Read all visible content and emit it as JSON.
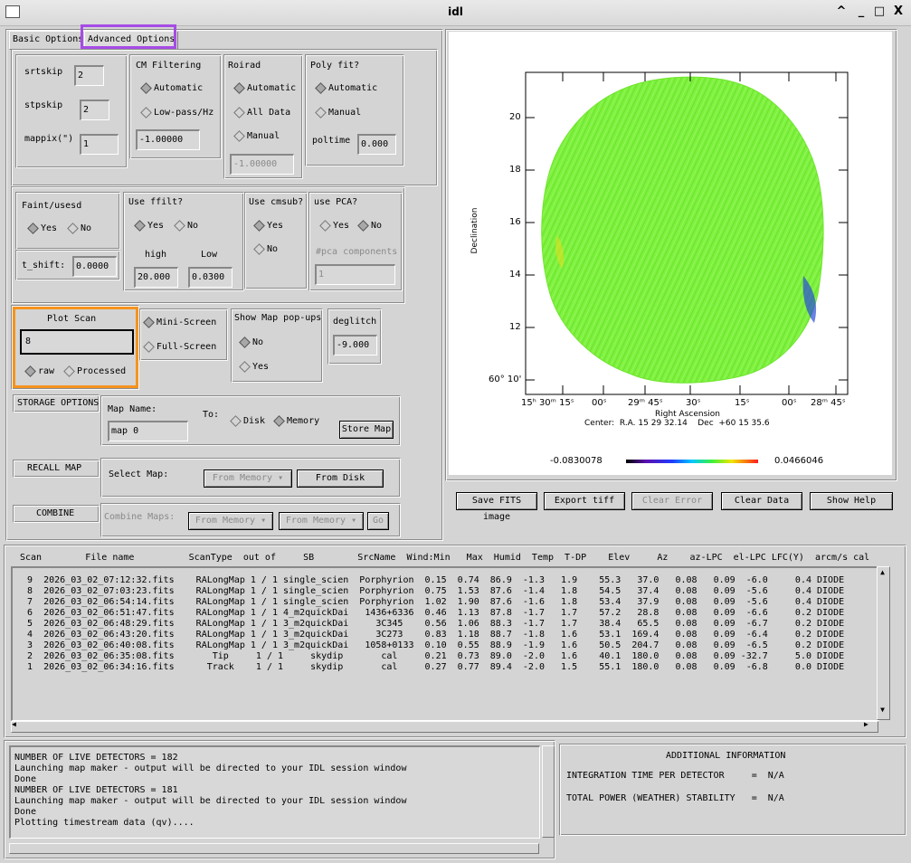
{
  "window": {
    "title": "idl",
    "controls": [
      "^",
      "_",
      "□",
      "X"
    ]
  },
  "tabs": [
    {
      "label": "Basic Options"
    },
    {
      "label": "Advanced Options"
    }
  ],
  "advanced": {
    "srtskip": {
      "label": "srtskip",
      "value": "2"
    },
    "stpskip": {
      "label": "stpskip",
      "value": "2"
    },
    "mappix": {
      "label": "mappix(\")",
      "value": "1"
    },
    "cm_filtering": {
      "label": "CM Filtering",
      "opt1": "Automatic",
      "opt2": "Low-pass/Hz",
      "value": "-1.00000"
    },
    "roirad": {
      "label": "Roirad",
      "opt1": "Automatic",
      "opt2": "All Data",
      "opt3": "Manual",
      "value": "-1.00000"
    },
    "polyfit": {
      "label": "Poly fit?",
      "opt1": "Automatic",
      "opt2": "Manual",
      "poltime_label": "poltime",
      "poltime_value": "0.000"
    },
    "faint": {
      "label": "Faint/usesd",
      "yes": "Yes",
      "no": "No"
    },
    "tshift": {
      "label": "t_shift:",
      "value": "0.0000"
    },
    "ffilt": {
      "label": "Use ffilt?",
      "yes": "Yes",
      "no": "No",
      "high_label": "high",
      "low_label": "Low",
      "high": "20.000",
      "low": "0.0300"
    },
    "cmsub": {
      "label": "Use cmsub?",
      "yes": "Yes",
      "no": "No"
    },
    "pca": {
      "label": "use PCA?",
      "yes": "Yes",
      "no": "No",
      "comp_label": "#pca components",
      "comp_value": "1"
    },
    "plotscan": {
      "label": "Plot Scan",
      "value": "8",
      "raw": "raw",
      "processed": "Processed"
    },
    "screen": {
      "mini": "Mini-Screen",
      "full": "Full-Screen"
    },
    "popups": {
      "label": "Show Map pop-ups",
      "no": "No",
      "yes": "Yes"
    },
    "deglitch": {
      "label": "deglitch",
      "value": "-9.000"
    },
    "storage": {
      "label": "STORAGE OPTIONS",
      "mapname_label": "Map Name:",
      "mapname_value": "map 0",
      "to_label": "To:",
      "disk": "Disk",
      "memory": "Memory",
      "store": "Store Map"
    },
    "recall": {
      "label": "RECALL MAP",
      "select_label": "Select Map:",
      "from_memory": "From Memory",
      "from_disk": "From Disk"
    },
    "combine": {
      "label": "COMBINE",
      "combine_label": "Combine Maps:",
      "from_memory1": "From Memory",
      "from_memory2": "From Memory",
      "go": "Go"
    }
  },
  "plot": {
    "ylabel": "Declination",
    "xlabel": "Right Ascension",
    "yticks": [
      "20",
      "18",
      "16",
      "14",
      "12",
      "60° 10'"
    ],
    "xticks": [
      "15ʰ 30ᵐ 15ˢ",
      "00ˢ",
      "29ᵐ 45ˢ",
      "30ˢ",
      "15ˢ",
      "00ˢ",
      "28ᵐ 45ˢ"
    ],
    "center": "Center:  R.A. 15 29 32.14    Dec  +60 15 35.6",
    "cmin": "-0.0830078",
    "cmax": "0.0466046"
  },
  "plot_buttons": [
    "Save FITS image",
    "Export tiff",
    "Clear Error",
    "Clear Data",
    "Show Help"
  ],
  "table": {
    "header": "Scan        File name          ScanType  out of     SB        SrcName  Wind:Min   Max  Humid  Temp  T-DP    Elev     Az    az-LPC  el-LPC LFC(Y)  arcm/s cal",
    "rows": [
      "  9  2026_03_02_07:12:32.fits    RALongMap 1 / 1 single_scien  Porphyrion  0.15  0.74  86.9  -1.3   1.9    55.3   37.0   0.08   0.09  -6.0     0.4 DIODE",
      "  8  2026_03_02_07:03:23.fits    RALongMap 1 / 1 single_scien  Porphyrion  0.75  1.53  87.6  -1.4   1.8    54.5   37.4   0.08   0.09  -5.6     0.4 DIODE",
      "  7  2026_03_02_06:54:14.fits    RALongMap 1 / 1 single_scien  Porphyrion  1.02  1.90  87.6  -1.6   1.8    53.4   37.9   0.08   0.09  -5.6     0.4 DIODE",
      "  6  2026_03_02_06:51:47.fits    RALongMap 1 / 1 4_m2quickDai   1436+6336  0.46  1.13  87.8  -1.7   1.7    57.2   28.8   0.08   0.09  -6.6     0.2 DIODE",
      "  5  2026_03_02_06:48:29.fits    RALongMap 1 / 1 3_m2quickDai     3C345    0.56  1.06  88.3  -1.7   1.7    38.4   65.5   0.08   0.09  -6.7     0.2 DIODE",
      "  4  2026_03_02_06:43:20.fits    RALongMap 1 / 1 3_m2quickDai     3C273    0.83  1.18  88.7  -1.8   1.6    53.1  169.4   0.08   0.09  -6.4     0.2 DIODE",
      "  3  2026_03_02_06:40:08.fits    RALongMap 1 / 1 3_m2quickDai   1058+0133  0.10  0.55  88.9  -1.9   1.6    50.5  204.7   0.08   0.09  -6.5     0.2 DIODE",
      "  2  2026_03_02_06:35:08.fits       Tip     1 / 1     skydip       cal     0.21  0.73  89.0  -2.0   1.6    40.1  180.0   0.08   0.09 -32.7     5.0 DIODE",
      "  1  2026_03_02_06:34:16.fits      Track    1 / 1     skydip       cal     0.27  0.77  89.4  -2.0   1.5    55.1  180.0   0.08   0.09  -6.8     0.0 DIODE"
    ]
  },
  "log": [
    "NUMBER OF LIVE DETECTORS = 182",
    "Launching map maker - output will be directed to your IDL session window",
    "Done",
    "NUMBER OF LIVE DETECTORS = 181",
    "Launching map maker - output will be directed to your IDL session window",
    "Done",
    "Plotting timestream data (qv)...."
  ],
  "info": {
    "title": "ADDITIONAL INFORMATION",
    "line1": "INTEGRATION TIME PER DETECTOR     =  N/A",
    "line2": "TOTAL POWER (WEATHER) STABILITY   =  N/A"
  },
  "colors": {
    "highlight_tab": "#a64ce6",
    "highlight_plotscan": "#f5931e",
    "map_fill": "#7ef23c"
  }
}
